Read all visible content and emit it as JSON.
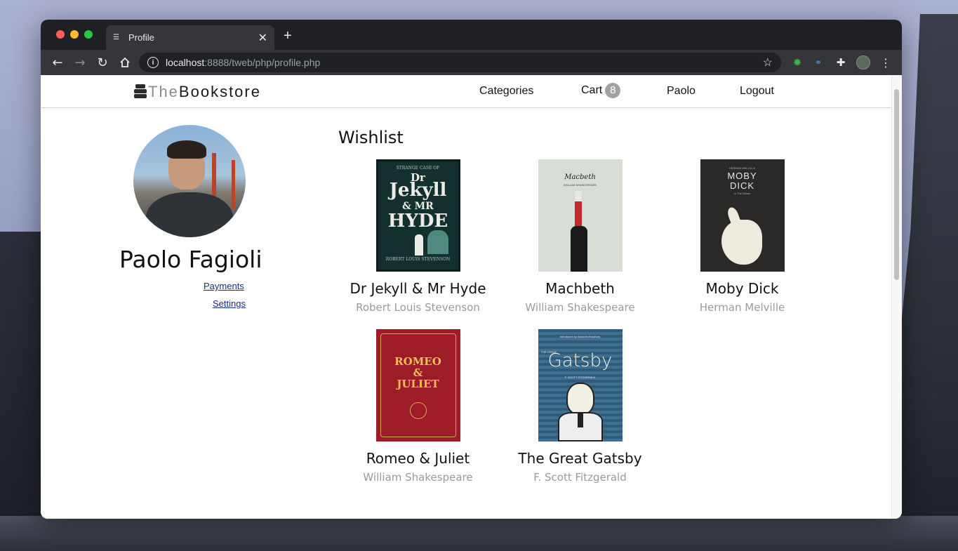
{
  "browser": {
    "tab_title": "Profile",
    "url_host": "localhost",
    "url_rest": ":8888/tweb/php/profile.php",
    "new_tab_label": "+",
    "close_label": "✕"
  },
  "site": {
    "logo_the": "The",
    "logo_bookstore": "Bookstore",
    "nav": {
      "categories": "Categories",
      "cart": "Cart",
      "cart_count": "8",
      "user": "Paolo",
      "logout": "Logout"
    }
  },
  "profile": {
    "name": "Paolo Fagioli",
    "payments_link": "Payments",
    "settings_link": "Settings"
  },
  "wishlist": {
    "title": "Wishlist",
    "books": [
      {
        "title": "Dr Jekyll & Mr Hyde",
        "author": "Robert Louis Stevenson"
      },
      {
        "title": "Machbeth",
        "author": "William Shakespeare"
      },
      {
        "title": "Moby Dick",
        "author": "Herman Melville"
      },
      {
        "title": "Romeo & Juliet",
        "author": "William Shakespeare"
      },
      {
        "title": "The Great Gatsby",
        "author": "F. Scott Fitzgerald"
      }
    ]
  },
  "covers": {
    "jekyll": {
      "top": "STRANGE CASE OF",
      "line1": "Dr",
      "line2": "Jekyll",
      "line3": "& MR",
      "line4": "HYDE",
      "bottom": "ROBERT LOUIS STEVENSON"
    },
    "macbeth": {
      "title": "Macbeth",
      "byline": "WILLIAM SHAKESPEARE"
    },
    "moby": {
      "author": "HERMAN MELVILLE",
      "line1": "MOBY",
      "line2": "DICK",
      "sub": "or The Whale"
    },
    "romeo": {
      "line1": "ROMEO",
      "line2": "&",
      "line3": "JULIET"
    },
    "gatsby": {
      "intro": "Introduced by Malcolm Bradbury",
      "the": "THE GREAT",
      "title": "Gatsby",
      "author": "F. SCOTT FITZGERALD"
    }
  },
  "colors": {
    "accent_link": "#1c2f7a",
    "cart_badge": "#a2a2a2",
    "author_gray": "#9a9a9a"
  }
}
